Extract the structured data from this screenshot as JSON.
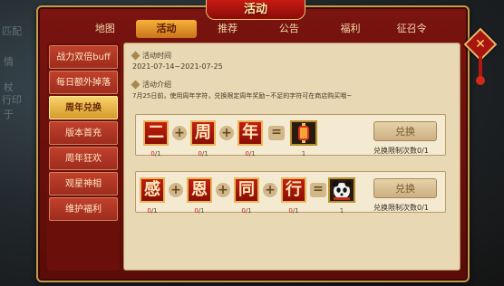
{
  "window": {
    "title": "活动"
  },
  "background": {
    "left_texts": [
      "匹配",
      "情",
      "杖",
      "行印",
      "于"
    ]
  },
  "tabs": [
    {
      "label": "地图"
    },
    {
      "label": "活动"
    },
    {
      "label": "推荐"
    },
    {
      "label": "公告"
    },
    {
      "label": "福利"
    },
    {
      "label": "征召令"
    }
  ],
  "active_tab": "活动",
  "sidebar": {
    "items": [
      {
        "label": "战力双倍buff"
      },
      {
        "label": "每日额外掉落"
      },
      {
        "label": "周年兑换"
      },
      {
        "label": "版本首充"
      },
      {
        "label": "周年狂欢"
      },
      {
        "label": "观星神相"
      },
      {
        "label": "维护福利"
      }
    ],
    "active": "周年兑换"
  },
  "content": {
    "time_label": "活动时间",
    "time_value": "2021-07-14~2021-07-25",
    "intro_label": "活动介绍",
    "intro_text": "7月25日前，使用周年字符，兑换限定周年奖励~不足的字符可在商店购买哦~",
    "rows": [
      {
        "chars": [
          {
            "char": "二",
            "count": "0",
            "need": "/1"
          },
          {
            "char": "周",
            "count": "0",
            "need": "/1"
          },
          {
            "char": "年",
            "count": "0",
            "need": "/1"
          }
        ],
        "reward_count": "1",
        "button": "兑换",
        "limit": "兑换限制次数0/1"
      },
      {
        "chars": [
          {
            "char": "感",
            "count": "0",
            "need": "/1"
          },
          {
            "char": "恩",
            "count": "0",
            "need": "/1"
          },
          {
            "char": "同",
            "count": "0",
            "need": "/1"
          },
          {
            "char": "行",
            "count": "0",
            "need": "/1"
          }
        ],
        "reward_count": "1",
        "button": "兑换",
        "limit": "兑换限制次数0/1"
      }
    ],
    "plus": "+",
    "equals": "="
  },
  "icons": {
    "close": "close-icon",
    "reward1": "lantern-reward-icon",
    "reward2": "panda-reward-icon"
  },
  "colors": {
    "frame": "#7a1410",
    "gold": "#c79a4a",
    "tab_active": "#f6b23a",
    "char_bg": "#c41e10"
  }
}
